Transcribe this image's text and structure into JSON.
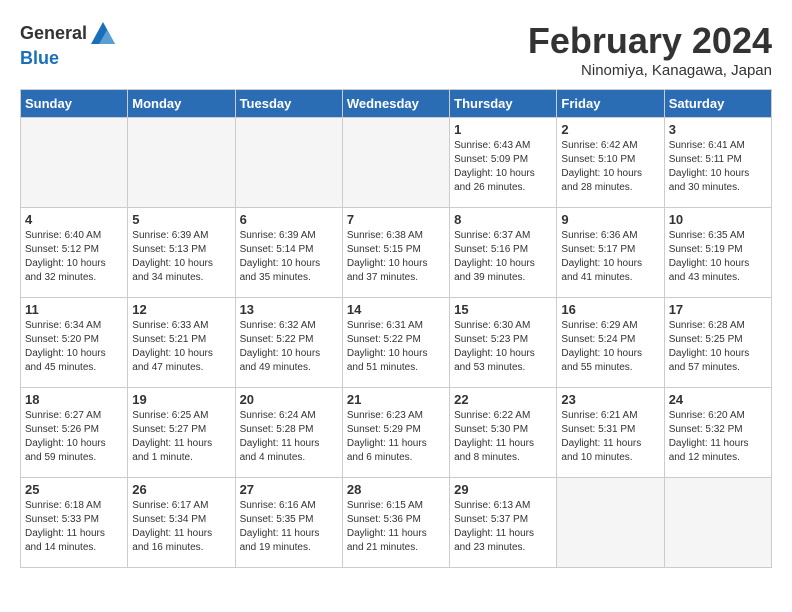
{
  "header": {
    "logo_line1": "General",
    "logo_line2": "Blue",
    "month_title": "February 2024",
    "location": "Ninomiya, Kanagawa, Japan"
  },
  "days_of_week": [
    "Sunday",
    "Monday",
    "Tuesday",
    "Wednesday",
    "Thursday",
    "Friday",
    "Saturday"
  ],
  "weeks": [
    [
      {
        "day": "",
        "info": ""
      },
      {
        "day": "",
        "info": ""
      },
      {
        "day": "",
        "info": ""
      },
      {
        "day": "",
        "info": ""
      },
      {
        "day": "1",
        "info": "Sunrise: 6:43 AM\nSunset: 5:09 PM\nDaylight: 10 hours and 26 minutes."
      },
      {
        "day": "2",
        "info": "Sunrise: 6:42 AM\nSunset: 5:10 PM\nDaylight: 10 hours and 28 minutes."
      },
      {
        "day": "3",
        "info": "Sunrise: 6:41 AM\nSunset: 5:11 PM\nDaylight: 10 hours and 30 minutes."
      }
    ],
    [
      {
        "day": "4",
        "info": "Sunrise: 6:40 AM\nSunset: 5:12 PM\nDaylight: 10 hours and 32 minutes."
      },
      {
        "day": "5",
        "info": "Sunrise: 6:39 AM\nSunset: 5:13 PM\nDaylight: 10 hours and 34 minutes."
      },
      {
        "day": "6",
        "info": "Sunrise: 6:39 AM\nSunset: 5:14 PM\nDaylight: 10 hours and 35 minutes."
      },
      {
        "day": "7",
        "info": "Sunrise: 6:38 AM\nSunset: 5:15 PM\nDaylight: 10 hours and 37 minutes."
      },
      {
        "day": "8",
        "info": "Sunrise: 6:37 AM\nSunset: 5:16 PM\nDaylight: 10 hours and 39 minutes."
      },
      {
        "day": "9",
        "info": "Sunrise: 6:36 AM\nSunset: 5:17 PM\nDaylight: 10 hours and 41 minutes."
      },
      {
        "day": "10",
        "info": "Sunrise: 6:35 AM\nSunset: 5:19 PM\nDaylight: 10 hours and 43 minutes."
      }
    ],
    [
      {
        "day": "11",
        "info": "Sunrise: 6:34 AM\nSunset: 5:20 PM\nDaylight: 10 hours and 45 minutes."
      },
      {
        "day": "12",
        "info": "Sunrise: 6:33 AM\nSunset: 5:21 PM\nDaylight: 10 hours and 47 minutes."
      },
      {
        "day": "13",
        "info": "Sunrise: 6:32 AM\nSunset: 5:22 PM\nDaylight: 10 hours and 49 minutes."
      },
      {
        "day": "14",
        "info": "Sunrise: 6:31 AM\nSunset: 5:22 PM\nDaylight: 10 hours and 51 minutes."
      },
      {
        "day": "15",
        "info": "Sunrise: 6:30 AM\nSunset: 5:23 PM\nDaylight: 10 hours and 53 minutes."
      },
      {
        "day": "16",
        "info": "Sunrise: 6:29 AM\nSunset: 5:24 PM\nDaylight: 10 hours and 55 minutes."
      },
      {
        "day": "17",
        "info": "Sunrise: 6:28 AM\nSunset: 5:25 PM\nDaylight: 10 hours and 57 minutes."
      }
    ],
    [
      {
        "day": "18",
        "info": "Sunrise: 6:27 AM\nSunset: 5:26 PM\nDaylight: 10 hours and 59 minutes."
      },
      {
        "day": "19",
        "info": "Sunrise: 6:25 AM\nSunset: 5:27 PM\nDaylight: 11 hours and 1 minute."
      },
      {
        "day": "20",
        "info": "Sunrise: 6:24 AM\nSunset: 5:28 PM\nDaylight: 11 hours and 4 minutes."
      },
      {
        "day": "21",
        "info": "Sunrise: 6:23 AM\nSunset: 5:29 PM\nDaylight: 11 hours and 6 minutes."
      },
      {
        "day": "22",
        "info": "Sunrise: 6:22 AM\nSunset: 5:30 PM\nDaylight: 11 hours and 8 minutes."
      },
      {
        "day": "23",
        "info": "Sunrise: 6:21 AM\nSunset: 5:31 PM\nDaylight: 11 hours and 10 minutes."
      },
      {
        "day": "24",
        "info": "Sunrise: 6:20 AM\nSunset: 5:32 PM\nDaylight: 11 hours and 12 minutes."
      }
    ],
    [
      {
        "day": "25",
        "info": "Sunrise: 6:18 AM\nSunset: 5:33 PM\nDaylight: 11 hours and 14 minutes."
      },
      {
        "day": "26",
        "info": "Sunrise: 6:17 AM\nSunset: 5:34 PM\nDaylight: 11 hours and 16 minutes."
      },
      {
        "day": "27",
        "info": "Sunrise: 6:16 AM\nSunset: 5:35 PM\nDaylight: 11 hours and 19 minutes."
      },
      {
        "day": "28",
        "info": "Sunrise: 6:15 AM\nSunset: 5:36 PM\nDaylight: 11 hours and 21 minutes."
      },
      {
        "day": "29",
        "info": "Sunrise: 6:13 AM\nSunset: 5:37 PM\nDaylight: 11 hours and 23 minutes."
      },
      {
        "day": "",
        "info": ""
      },
      {
        "day": "",
        "info": ""
      }
    ]
  ]
}
